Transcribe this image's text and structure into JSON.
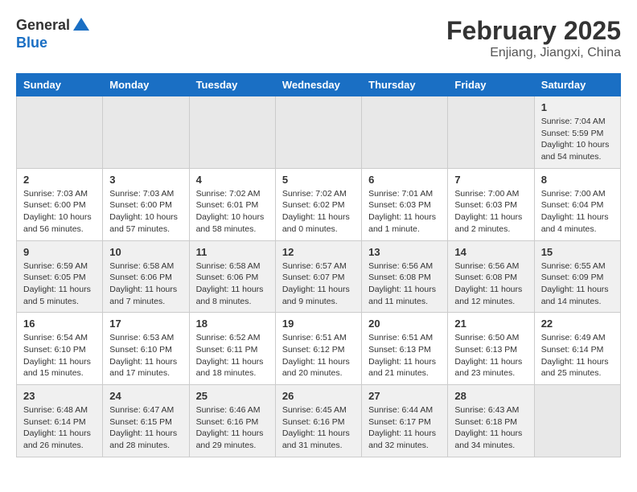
{
  "logo": {
    "general": "General",
    "blue": "Blue"
  },
  "title": {
    "month": "February 2025",
    "location": "Enjiang, Jiangxi, China"
  },
  "weekdays": [
    "Sunday",
    "Monday",
    "Tuesday",
    "Wednesday",
    "Thursday",
    "Friday",
    "Saturday"
  ],
  "weeks": [
    [
      {
        "day": "",
        "info": ""
      },
      {
        "day": "",
        "info": ""
      },
      {
        "day": "",
        "info": ""
      },
      {
        "day": "",
        "info": ""
      },
      {
        "day": "",
        "info": ""
      },
      {
        "day": "",
        "info": ""
      },
      {
        "day": "1",
        "info": "Sunrise: 7:04 AM\nSunset: 5:59 PM\nDaylight: 10 hours\nand 54 minutes."
      }
    ],
    [
      {
        "day": "2",
        "info": "Sunrise: 7:03 AM\nSunset: 6:00 PM\nDaylight: 10 hours\nand 56 minutes."
      },
      {
        "day": "3",
        "info": "Sunrise: 7:03 AM\nSunset: 6:00 PM\nDaylight: 10 hours\nand 57 minutes."
      },
      {
        "day": "4",
        "info": "Sunrise: 7:02 AM\nSunset: 6:01 PM\nDaylight: 10 hours\nand 58 minutes."
      },
      {
        "day": "5",
        "info": "Sunrise: 7:02 AM\nSunset: 6:02 PM\nDaylight: 11 hours\nand 0 minutes."
      },
      {
        "day": "6",
        "info": "Sunrise: 7:01 AM\nSunset: 6:03 PM\nDaylight: 11 hours\nand 1 minute."
      },
      {
        "day": "7",
        "info": "Sunrise: 7:00 AM\nSunset: 6:03 PM\nDaylight: 11 hours\nand 2 minutes."
      },
      {
        "day": "8",
        "info": "Sunrise: 7:00 AM\nSunset: 6:04 PM\nDaylight: 11 hours\nand 4 minutes."
      }
    ],
    [
      {
        "day": "9",
        "info": "Sunrise: 6:59 AM\nSunset: 6:05 PM\nDaylight: 11 hours\nand 5 minutes."
      },
      {
        "day": "10",
        "info": "Sunrise: 6:58 AM\nSunset: 6:06 PM\nDaylight: 11 hours\nand 7 minutes."
      },
      {
        "day": "11",
        "info": "Sunrise: 6:58 AM\nSunset: 6:06 PM\nDaylight: 11 hours\nand 8 minutes."
      },
      {
        "day": "12",
        "info": "Sunrise: 6:57 AM\nSunset: 6:07 PM\nDaylight: 11 hours\nand 9 minutes."
      },
      {
        "day": "13",
        "info": "Sunrise: 6:56 AM\nSunset: 6:08 PM\nDaylight: 11 hours\nand 11 minutes."
      },
      {
        "day": "14",
        "info": "Sunrise: 6:56 AM\nSunset: 6:08 PM\nDaylight: 11 hours\nand 12 minutes."
      },
      {
        "day": "15",
        "info": "Sunrise: 6:55 AM\nSunset: 6:09 PM\nDaylight: 11 hours\nand 14 minutes."
      }
    ],
    [
      {
        "day": "16",
        "info": "Sunrise: 6:54 AM\nSunset: 6:10 PM\nDaylight: 11 hours\nand 15 minutes."
      },
      {
        "day": "17",
        "info": "Sunrise: 6:53 AM\nSunset: 6:10 PM\nDaylight: 11 hours\nand 17 minutes."
      },
      {
        "day": "18",
        "info": "Sunrise: 6:52 AM\nSunset: 6:11 PM\nDaylight: 11 hours\nand 18 minutes."
      },
      {
        "day": "19",
        "info": "Sunrise: 6:51 AM\nSunset: 6:12 PM\nDaylight: 11 hours\nand 20 minutes."
      },
      {
        "day": "20",
        "info": "Sunrise: 6:51 AM\nSunset: 6:13 PM\nDaylight: 11 hours\nand 21 minutes."
      },
      {
        "day": "21",
        "info": "Sunrise: 6:50 AM\nSunset: 6:13 PM\nDaylight: 11 hours\nand 23 minutes."
      },
      {
        "day": "22",
        "info": "Sunrise: 6:49 AM\nSunset: 6:14 PM\nDaylight: 11 hours\nand 25 minutes."
      }
    ],
    [
      {
        "day": "23",
        "info": "Sunrise: 6:48 AM\nSunset: 6:14 PM\nDaylight: 11 hours\nand 26 minutes."
      },
      {
        "day": "24",
        "info": "Sunrise: 6:47 AM\nSunset: 6:15 PM\nDaylight: 11 hours\nand 28 minutes."
      },
      {
        "day": "25",
        "info": "Sunrise: 6:46 AM\nSunset: 6:16 PM\nDaylight: 11 hours\nand 29 minutes."
      },
      {
        "day": "26",
        "info": "Sunrise: 6:45 AM\nSunset: 6:16 PM\nDaylight: 11 hours\nand 31 minutes."
      },
      {
        "day": "27",
        "info": "Sunrise: 6:44 AM\nSunset: 6:17 PM\nDaylight: 11 hours\nand 32 minutes."
      },
      {
        "day": "28",
        "info": "Sunrise: 6:43 AM\nSunset: 6:18 PM\nDaylight: 11 hours\nand 34 minutes."
      },
      {
        "day": "",
        "info": ""
      }
    ]
  ]
}
